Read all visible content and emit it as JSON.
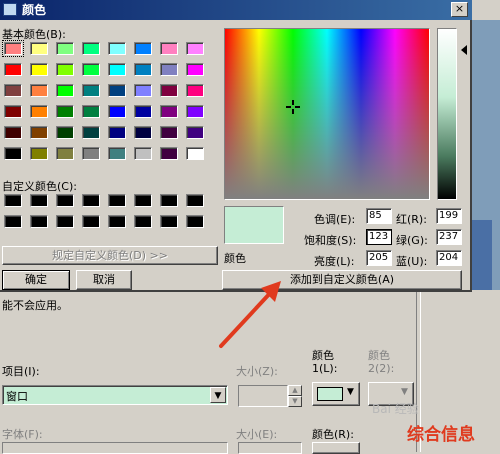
{
  "dialog": {
    "title": "颜色",
    "close_glyph": "×",
    "basic_colors_label": "基本颜色(B):",
    "custom_colors_label": "自定义颜色(C):",
    "define_custom_label": "规定自定义颜色(D) >>",
    "ok_label": "确定",
    "cancel_label": "取消",
    "preview_label": "颜色",
    "add_custom_label": "添加到自定义颜色(A)",
    "hue_label": "色调(E):",
    "sat_label": "饱和度(S):",
    "lum_label": "亮度(L):",
    "red_label": "红(R):",
    "green_label": "绿(G):",
    "blue_label": "蓝(U):",
    "hue_value": "85",
    "sat_value": "123",
    "lum_value": "205",
    "red_value": "199",
    "green_value": "237",
    "blue_value": "204"
  },
  "basic_colors": [
    [
      "#ff8080",
      "#ffff80",
      "#80ff80",
      "#00ff80",
      "#80ffff",
      "#0080ff",
      "#ff80c0",
      "#ff80ff"
    ],
    [
      "#ff0000",
      "#ffff00",
      "#80ff00",
      "#00ff40",
      "#00ffff",
      "#0080c0",
      "#8080c0",
      "#ff00ff"
    ],
    [
      "#804040",
      "#ff8040",
      "#00ff00",
      "#008080",
      "#004080",
      "#8080ff",
      "#800040",
      "#ff0080"
    ],
    [
      "#800000",
      "#ff8000",
      "#008000",
      "#008040",
      "#0000ff",
      "#0000a0",
      "#800080",
      "#8000ff"
    ],
    [
      "#400000",
      "#804000",
      "#004000",
      "#004040",
      "#000080",
      "#000040",
      "#400040",
      "#400080"
    ],
    [
      "#000000",
      "#808000",
      "#808040",
      "#808080",
      "#408080",
      "#c0c0c0",
      "#400040",
      "#ffffff"
    ]
  ],
  "background": {
    "note_text": "能不会应用。",
    "item_label": "项目(I):",
    "item_value": "窗口",
    "size_label": "大小(Z):",
    "color1_label_a": "颜色",
    "color1_label_b": "1(L):",
    "color2_label_a": "颜色",
    "color2_label_b": "2(2):",
    "font_label": "字体(F):",
    "size2_label": "大小(E):",
    "color_r_label": "颜色(R):",
    "color1_value": "#c5edd5"
  },
  "watermark": {
    "logo_text": "Bai 经验",
    "caption": "综合信息"
  },
  "colors": {
    "selected": "#c7edcc",
    "title_start": "#0a246a",
    "title_end": "#3a6ea5",
    "arrow": "#e03a1e"
  }
}
